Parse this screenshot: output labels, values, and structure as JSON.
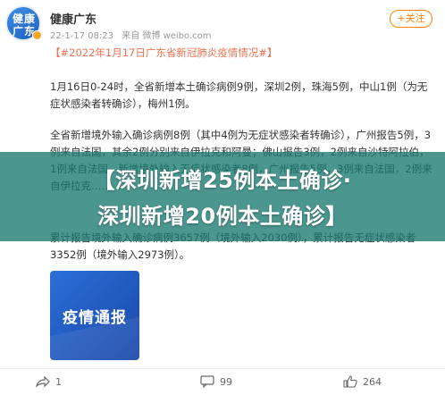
{
  "header": {
    "avatar_text": "健康\n广东",
    "username": "健康广东",
    "time": "22-1-17 08:23",
    "source": "来自 微博 weibo.com",
    "follow_label": "+关注"
  },
  "post": {
    "hashtag": "【#2022年1月17日广东省新冠肺炎疫情情况#】",
    "para1": "1月16日0-24时，全省新增本土确诊病例9例，深圳2例，珠海5例，中山1例（为无症状感染者转确诊），梅州1例。",
    "para2": "全省新增境外输入确诊病例8例（其中4例为无症状感染者转确诊），广州报告5例，3例来自法国，其余2例分别来自伊拉克和阿曼；佛山报告3例，2例来自沙特阿拉伯，1例来自法国。新增境外输入无症状感染者8例，广州报告5例，3例来自法国，2例来自伊拉克……",
    "para3": "累计报告境外输入确诊病例3657例（境外输入2030例），累计报告无症状感染者3352例（境外输入2973例）。"
  },
  "overlay": {
    "line1": "【深圳新增25例本土确诊·",
    "line2": "深圳新增20例本土确诊】"
  },
  "image_card": {
    "text": "疫情通报"
  },
  "actions": {
    "share_count": "1",
    "comment_count": "99",
    "like_count": "264"
  },
  "colors": {
    "accent": "#ff8200",
    "hashtag": "#eb7350",
    "overlay": "#187870"
  }
}
